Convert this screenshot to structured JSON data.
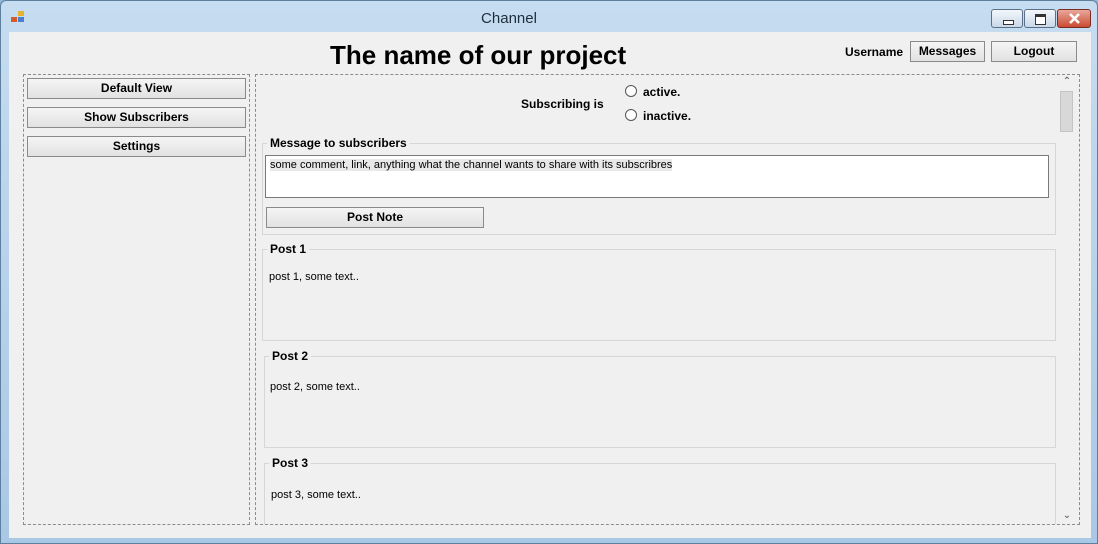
{
  "window": {
    "title": "Channel"
  },
  "header": {
    "project_title": "The name of our project",
    "username": "Username",
    "messages_label": "Messages",
    "logout_label": "Logout"
  },
  "sidebar": {
    "items": [
      {
        "label": "Default View"
      },
      {
        "label": "Show Subscribers"
      },
      {
        "label": "Settings"
      }
    ]
  },
  "subscribing": {
    "label": "Subscribing is",
    "options": [
      {
        "label": "active.",
        "selected": false
      },
      {
        "label": "inactive.",
        "selected": false
      }
    ]
  },
  "message": {
    "legend": "Message to subscribers",
    "value": "some comment, link, anything what the channel wants to share with its subscribres",
    "post_button": "Post Note"
  },
  "posts": [
    {
      "title": "Post 1",
      "text": "post 1, some text.."
    },
    {
      "title": "Post 2",
      "text": "post 2, some text.."
    },
    {
      "title": "Post 3",
      "text": "post 3, some text.."
    }
  ]
}
